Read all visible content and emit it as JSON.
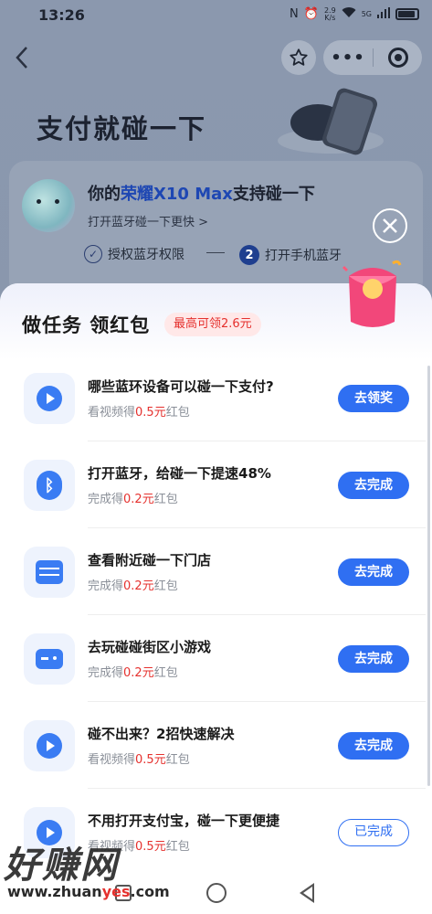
{
  "status_bar": {
    "time": "13:26",
    "speed_value": "2.9",
    "speed_unit": "K/s",
    "network": "5G"
  },
  "header": {
    "back_icon": "chevron-left-icon",
    "favorite_icon": "star-icon",
    "more_icon": "more-dots-icon",
    "close_mini_icon": "target-icon"
  },
  "hero": {
    "title": "支付就碰一下"
  },
  "device_card": {
    "title_prefix": "你的",
    "device_name": "荣耀X10 Max",
    "title_suffix": "支持碰一下",
    "subtitle": "打开蓝牙碰一下更快 >",
    "step1_label": "授权蓝牙权限",
    "step_separator": "——",
    "step2_number": "2",
    "step2_label": "打开手机蓝牙"
  },
  "sheet": {
    "title": "做任务 领红包",
    "badge": "最高可领2.6元",
    "tasks": [
      {
        "icon": "play-icon",
        "title": "哪些蓝环设备可以碰一下支付?",
        "reward_prefix": "看视频得",
        "reward_amount": "0.5元",
        "reward_suffix": "红包",
        "button": "去领奖",
        "done": false
      },
      {
        "icon": "bluetooth-icon",
        "title": "打开蓝牙，给碰一下提速48%",
        "reward_prefix": "完成得",
        "reward_amount": "0.2元",
        "reward_suffix": "红包",
        "button": "去完成",
        "done": false
      },
      {
        "icon": "store-icon",
        "title": "查看附近碰一下门店",
        "reward_prefix": "完成得",
        "reward_amount": "0.2元",
        "reward_suffix": "红包",
        "button": "去完成",
        "done": false
      },
      {
        "icon": "game-icon",
        "title": "去玩碰碰街区小游戏",
        "reward_prefix": "完成得",
        "reward_amount": "0.2元",
        "reward_suffix": "红包",
        "button": "去完成",
        "done": false
      },
      {
        "icon": "play-icon",
        "title": "碰不出来？2招快速解决",
        "reward_prefix": "看视频得",
        "reward_amount": "0.5元",
        "reward_suffix": "红包",
        "button": "去完成",
        "done": false
      },
      {
        "icon": "play-icon",
        "title": "不用打开支付宝，碰一下更便捷",
        "reward_prefix": "看视频得",
        "reward_amount": "0.5元",
        "reward_suffix": "红包",
        "button": "已完成",
        "done": true
      }
    ]
  },
  "watermark": {
    "main": "好赚网",
    "url_prefix": "www.zhuan",
    "url_highlight": "yes",
    "url_suffix": ".com"
  },
  "colors": {
    "accent": "#2f6ff2",
    "reward_red": "#e5312e",
    "overlay": "#8a97ad"
  }
}
